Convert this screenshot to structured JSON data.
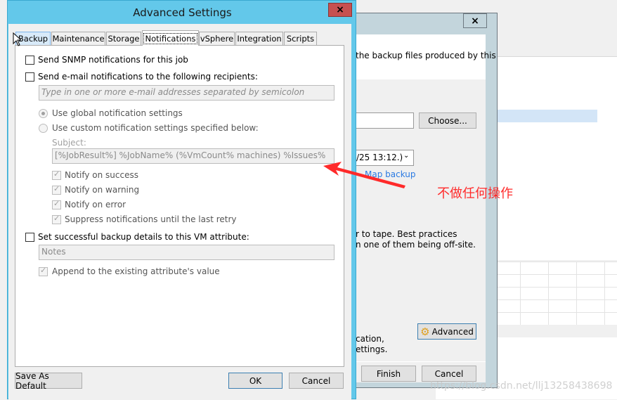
{
  "background_window": {
    "description_text": "the backup files produced by this",
    "choose_button": "Choose...",
    "restore_point_value": "/25 13:12.)",
    "map_backup_link": "Map backup",
    "tape_text_1": "r to tape. Best practices",
    "tape_text_2": "n one of them being off-site.",
    "advanced_text_1": "cation,",
    "advanced_text_2": "ettings.",
    "advanced_button": "Advanced",
    "finish_button": "Finish",
    "cancel_button": "Cancel",
    "close_icon": "×"
  },
  "dialog": {
    "title": "Advanced Settings",
    "close_icon": "×",
    "tabs": [
      {
        "label": "Backup"
      },
      {
        "label": "Maintenance"
      },
      {
        "label": "Storage"
      },
      {
        "label": "Notifications",
        "active": true
      },
      {
        "label": "vSphere"
      },
      {
        "label": "Integration"
      },
      {
        "label": "Scripts"
      }
    ],
    "snmp_label": "Send SNMP notifications for this job",
    "snmp_checked": false,
    "email_label": "Send e-mail notifications to the following recipients:",
    "email_checked": false,
    "email_placeholder": "Type in one or more e-mail addresses separated by semicolon",
    "use_global_label": "Use global notification settings",
    "use_global_selected": true,
    "use_custom_label": "Use custom notification settings specified below:",
    "subject_label": "Subject:",
    "subject_value": "[%JobResult%] %JobName% (%VmCount% machines) %Issues%",
    "notify_success": "Notify on success",
    "notify_warning": "Notify on warning",
    "notify_error": "Notify on error",
    "suppress": "Suppress notifications until the last retry",
    "vm_attribute_label": "Set successful backup details to this VM attribute:",
    "vm_attribute_checked": false,
    "vm_attribute_value": "Notes",
    "append_label": "Append to the existing attribute's value",
    "save_default_button": "Save As Default",
    "ok_button": "OK",
    "cancel_button": "Cancel"
  },
  "annotation": {
    "text": "不做任何操作",
    "color": "#ff2a2a"
  },
  "watermark": "https://blog.csdn.net/llj13258438698",
  "colors": {
    "dialog_frame": "#63c8ea",
    "close_red": "#c75050",
    "bg_frame": "#c3d5dc",
    "link": "#2a7ae2"
  }
}
